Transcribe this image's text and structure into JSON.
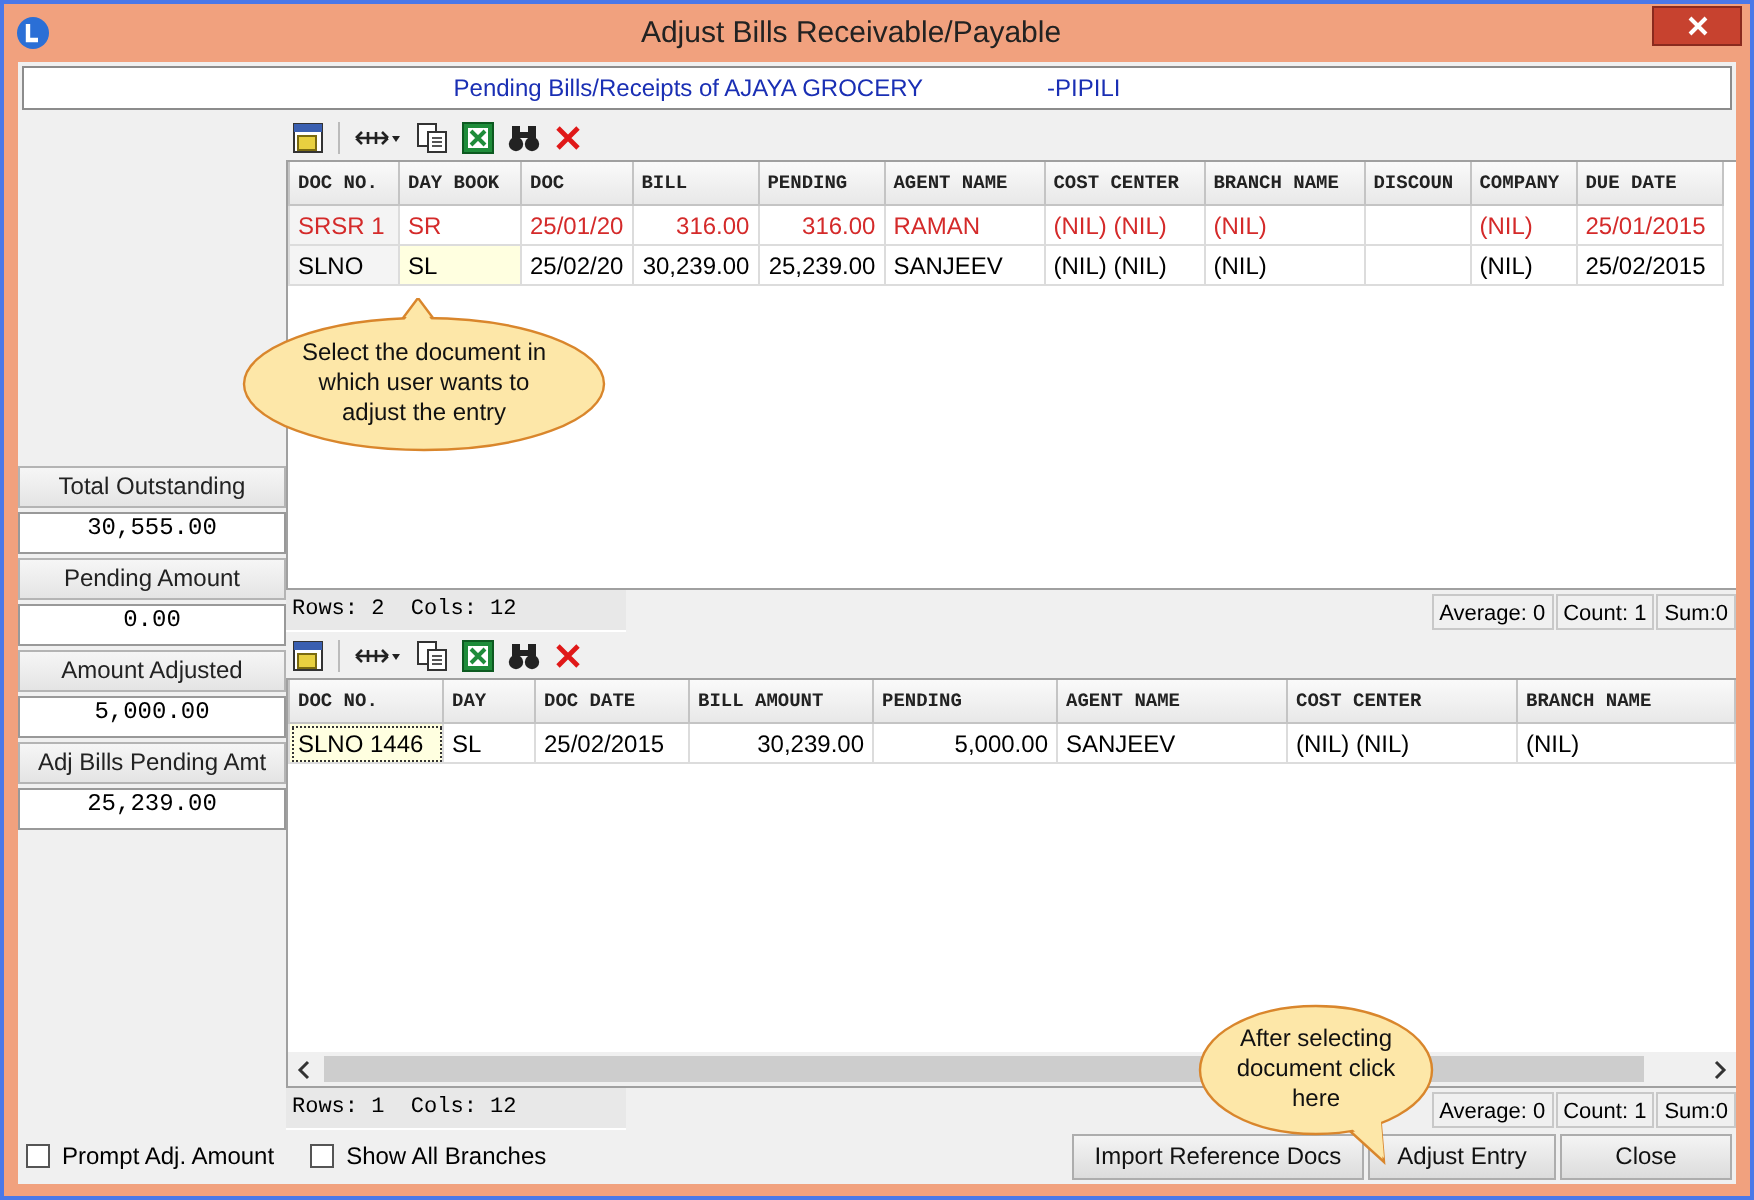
{
  "window": {
    "title": "Adjust Bills Receivable/Payable"
  },
  "header": {
    "title": "Pending Bills/Receipts of AJAYA GROCERY",
    "location": "-PIPILI"
  },
  "summary": [
    {
      "label": "Total Outstanding",
      "value": "30,555.00"
    },
    {
      "label": "Pending Amount",
      "value": "0.00"
    },
    {
      "label": "Amount Adjusted",
      "value": "5,000.00"
    },
    {
      "label": "Adj Bills Pending Amt",
      "value": "25,239.00"
    }
  ],
  "bills_grid": {
    "columns": [
      {
        "label": "DOC NO.",
        "kind": "text"
      },
      {
        "label": "DAY BOOK",
        "kind": "text"
      },
      {
        "label": "DOC",
        "kind": "text"
      },
      {
        "label": "BILL",
        "kind": "number"
      },
      {
        "label": "PENDING",
        "kind": "number"
      },
      {
        "label": "AGENT NAME",
        "kind": "text"
      },
      {
        "label": "COST CENTER",
        "kind": "text"
      },
      {
        "label": "BRANCH NAME",
        "kind": "text"
      },
      {
        "label": "DISCOUN",
        "kind": "text"
      },
      {
        "label": "COMPANY",
        "kind": "text"
      },
      {
        "label": "DUE DATE",
        "kind": "text"
      }
    ],
    "rows": [
      {
        "color": "#d42a2a",
        "cells": [
          {
            "text": "SRSR  1",
            "selected": false
          },
          {
            "text": "SR",
            "selected": false
          },
          {
            "text": "25/01/20",
            "selected": false
          },
          {
            "text": "316.00",
            "selected": false
          },
          {
            "text": "316.00",
            "selected": false
          },
          {
            "text": "RAMAN",
            "selected": false
          },
          {
            "text": "(NIL) (NIL)",
            "selected": false
          },
          {
            "text": "(NIL)",
            "selected": false
          },
          {
            "selected": false
          },
          {
            "text": "(NIL)",
            "selected": false
          },
          {
            "text": "25/01/2015",
            "selected": false
          }
        ]
      },
      {
        "color": "#000000",
        "cells": [
          {
            "text": "SLNO",
            "selected": false
          },
          {
            "text": "SL",
            "selected": true
          },
          {
            "text": "25/02/20",
            "selected": false
          },
          {
            "text": "30,239.00",
            "selected": false
          },
          {
            "text": "25,239.00",
            "selected": false
          },
          {
            "text": "SANJEEV",
            "selected": false
          },
          {
            "text": "(NIL) (NIL)",
            "selected": false
          },
          {
            "text": "(NIL)",
            "selected": false
          },
          {
            "selected": false
          },
          {
            "text": "(NIL)",
            "selected": false
          },
          {
            "text": "25/02/2015",
            "selected": false
          }
        ]
      }
    ],
    "status": {
      "rows_cols": "Rows: 2  Cols: 12",
      "average": "Average: 0",
      "count": "Count: 1",
      "sum": "Sum:0"
    }
  },
  "adjust_grid": {
    "columns": [
      {
        "label": "DOC NO.",
        "kind": "text"
      },
      {
        "label": "DAY",
        "kind": "text"
      },
      {
        "label": "DOC DATE",
        "kind": "text"
      },
      {
        "label": "BILL AMOUNT",
        "kind": "number"
      },
      {
        "label": "PENDING",
        "kind": "number"
      },
      {
        "label": "AGENT NAME",
        "kind": "text"
      },
      {
        "label": "COST CENTER",
        "kind": "text"
      },
      {
        "label": "BRANCH NAME",
        "kind": "text"
      }
    ],
    "rows": [
      {
        "color": "#000000",
        "cells": [
          {
            "text": "SLNO  1446",
            "selected": true
          },
          {
            "text": "SL",
            "selected": false
          },
          {
            "text": "25/02/2015",
            "selected": false
          },
          {
            "text": "30,239.00",
            "selected": false
          },
          {
            "text": "5,000.00",
            "selected": false
          },
          {
            "text": "SANJEEV",
            "selected": false
          },
          {
            "text": "(NIL) (NIL)",
            "selected": false
          },
          {
            "text": "(NIL)",
            "selected": false
          }
        ]
      }
    ],
    "status": {
      "rows_cols": "Rows: 1  Cols: 12",
      "average": "Average: 0",
      "count": "Count: 1",
      "sum": "Sum:0"
    }
  },
  "options": [
    {
      "label": "Prompt Adj. Amount",
      "checked": false
    },
    {
      "label": "Show All Branches",
      "checked": false
    }
  ],
  "buttons": [
    "Import Reference Docs",
    "Adjust Entry",
    "Close"
  ],
  "callouts": [
    {
      "text": "Select the document in which user wants to adjust the entry"
    },
    {
      "text": "After selecting document click here"
    }
  ]
}
